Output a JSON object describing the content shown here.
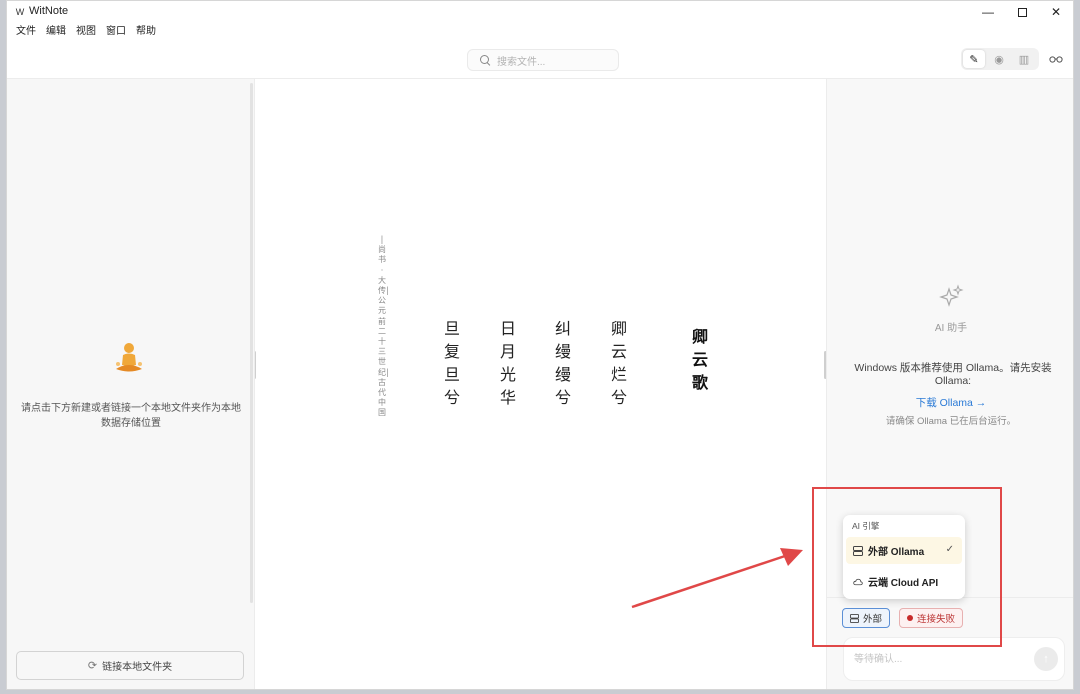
{
  "window": {
    "title": "WitNote",
    "app_icon": "W"
  },
  "menu": [
    "文件",
    "编辑",
    "视图",
    "窗口",
    "帮助"
  ],
  "toolbar": {
    "search_placeholder": "搜索文件...",
    "modes": [
      {
        "name": "edit-mode",
        "icon": "pencil-icon",
        "glyph": "✎",
        "active": true
      },
      {
        "name": "preview-mode",
        "icon": "eye-icon",
        "glyph": "◉",
        "active": false
      },
      {
        "name": "split-mode",
        "icon": "columns-icon",
        "glyph": "▥",
        "active": false
      }
    ],
    "reader_icon": "glasses-icon"
  },
  "sidebar": {
    "hint": "请点击下方新建或者链接一个本地文件夹作为本地数据存储位置",
    "link_folder_label": "链接本地文件夹"
  },
  "editor": {
    "poem_title": "卿云歌",
    "poem_lines": [
      "卿云烂兮",
      "纠缦缦兮",
      "日月光华",
      "旦复旦兮"
    ],
    "source_note": "|尚书·大传|公元前二十三世纪|古代中国"
  },
  "ai_panel": {
    "icon": "sparkle-icon",
    "label": "AI 助手",
    "message": "Windows 版本推荐使用 Ollama。请先安装 Ollama:",
    "download_link": "下载 Ollama →",
    "ensure_message": "请确保 Ollama 已在后台运行。",
    "engine_menu": {
      "heading": "AI 引擎",
      "options": [
        {
          "label": "外部 Ollama",
          "icon": "server-icon",
          "selected": true
        },
        {
          "label": "云端 Cloud API",
          "icon": "cloud-icon",
          "selected": false
        }
      ]
    },
    "engine_chip": "外部",
    "status_chip": "连接失败",
    "input_placeholder": "等待确认..."
  },
  "colors": {
    "accent_link": "#2a7ad6",
    "annotation_red": "#e04848",
    "status_error": "#c72b2b"
  }
}
